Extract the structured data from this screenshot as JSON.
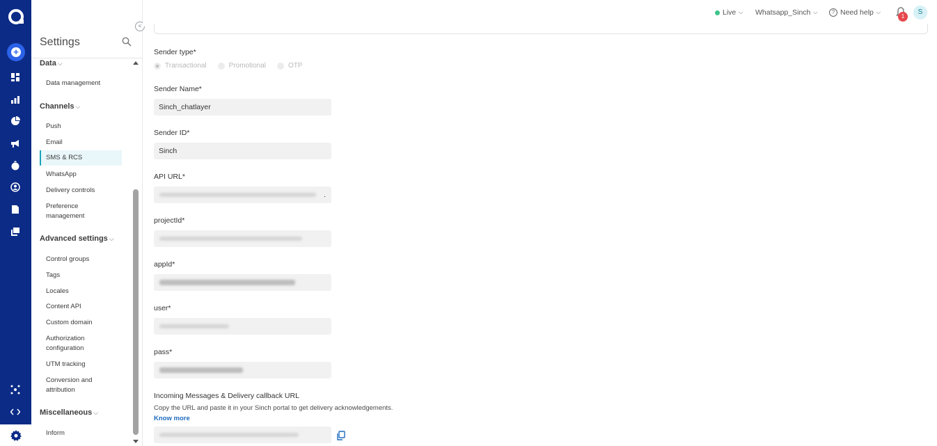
{
  "sidebar": {
    "title": "Settings",
    "sections": [
      {
        "label": "Data",
        "items": [
          "Data management"
        ]
      },
      {
        "label": "Channels",
        "items": [
          "Push",
          "Email",
          "SMS & RCS",
          "WhatsApp",
          "Delivery controls",
          "Preference management"
        ]
      },
      {
        "label": "Advanced settings",
        "items": [
          "Control groups",
          "Tags",
          "Locales",
          "Content API",
          "Custom domain",
          "Authorization configuration",
          "UTM tracking",
          "Conversion and attribution"
        ]
      },
      {
        "label": "Miscellaneous",
        "items": [
          "Inform"
        ]
      }
    ],
    "active_item": "SMS & RCS"
  },
  "topbar": {
    "env": "Live",
    "workspace": "Whatsapp_Sinch",
    "help": "Need help",
    "notification_count": "1",
    "avatar_initial": "S"
  },
  "form": {
    "sender_type_label": "Sender type*",
    "sender_type_options": [
      "Transactional",
      "Promotional",
      "OTP"
    ],
    "sender_type_selected": "Transactional",
    "sender_name_label": "Sender Name*",
    "sender_name_value": "Sinch_chatlayer",
    "sender_id_label": "Sender ID*",
    "sender_id_value": "Sinch",
    "api_url_label": "API URL*",
    "api_url_trailing": ".",
    "project_id_label": "projectId*",
    "app_id_label": "appId*",
    "user_label": "user*",
    "pass_label": "pass*",
    "callback_label": "Incoming Messages & Delivery callback URL",
    "callback_help": "Copy the URL and paste it in your Sinch portal to get delivery acknowledgements.",
    "know_more": "Know more"
  },
  "colors": {
    "rail": "#0b2b86",
    "accent": "#1aa3b8",
    "live": "#3cc48b",
    "badge": "#e5484d",
    "link": "#1f6bbf"
  }
}
